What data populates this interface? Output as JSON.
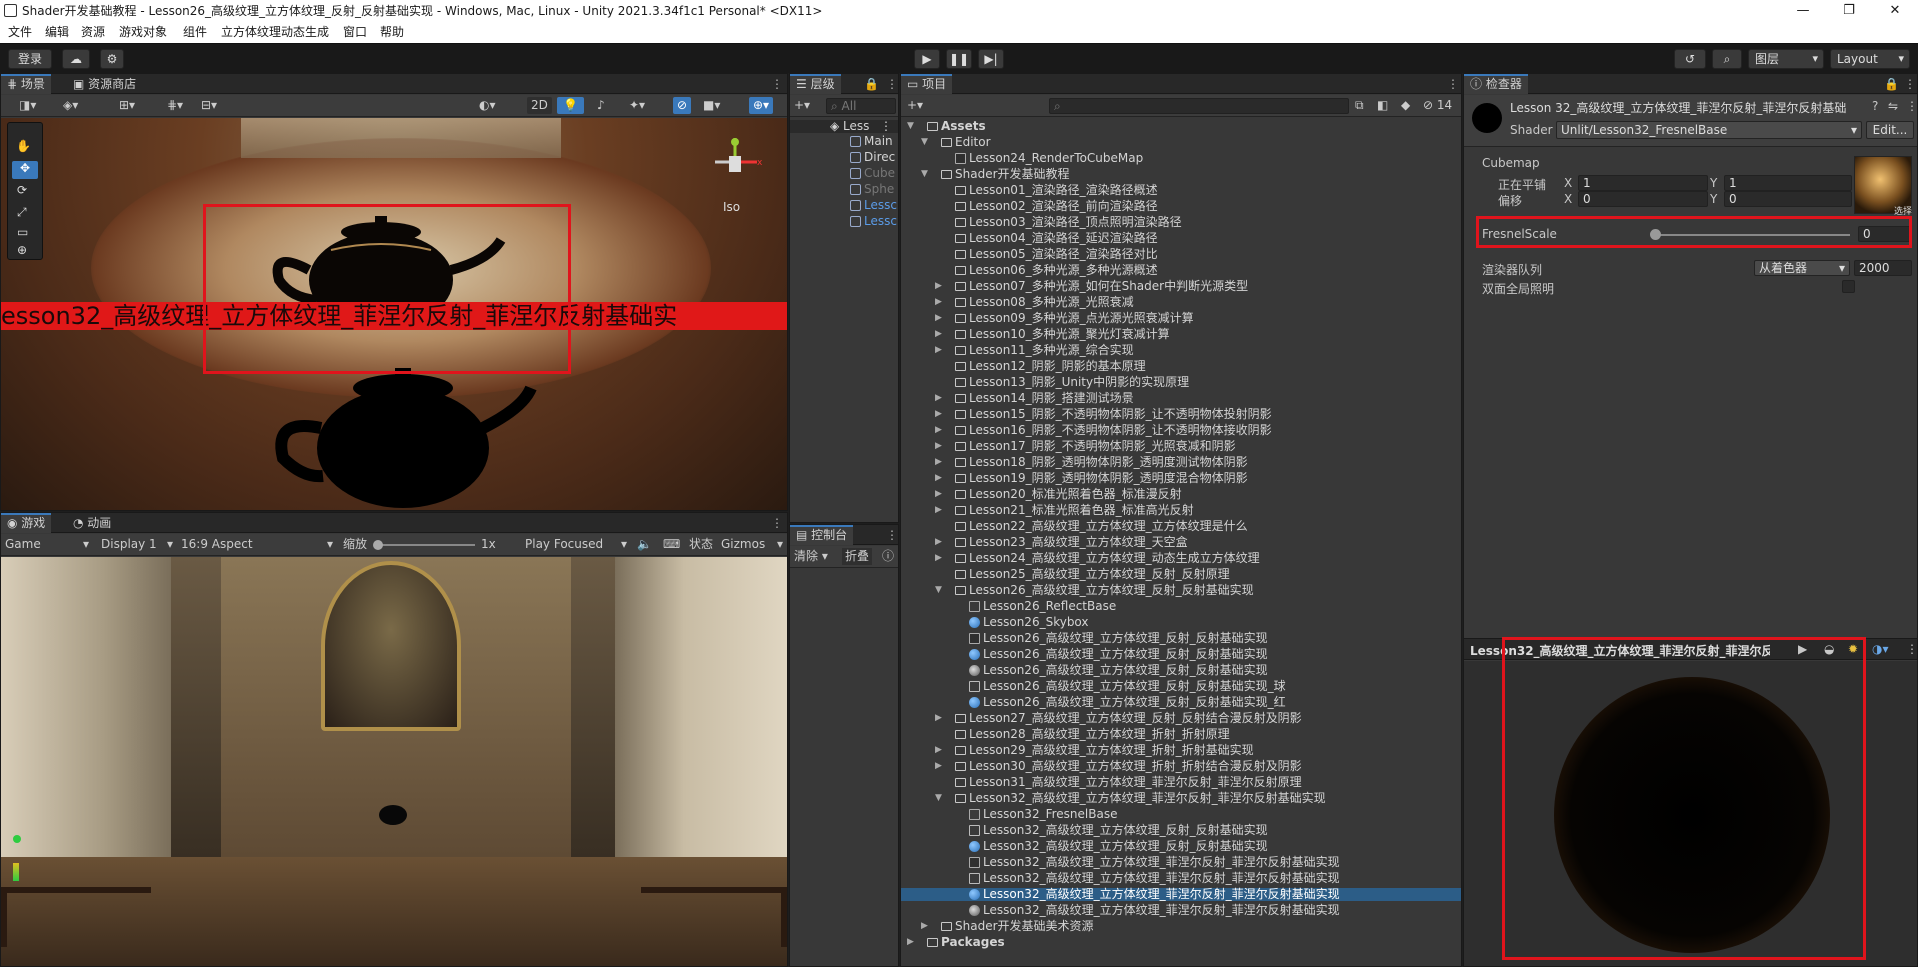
{
  "window": {
    "title": "Shader开发基础教程 - Lesson26_高级纹理_立方体纹理_反射_反射基础实现 - Windows, Mac, Linux - Unity 2021.3.34f1c1 Personal* <DX11>",
    "minimize": "—",
    "maximize": "❐",
    "close": "✕"
  },
  "menu": [
    "文件",
    "编辑",
    "资源",
    "游戏对象",
    "组件",
    "立方体纹理动态生成",
    "窗口",
    "帮助"
  ],
  "toolbar": {
    "login": "登录",
    "layers": "图层",
    "layout": "Layout"
  },
  "scene": {
    "tab_scene": "场景",
    "tab_store": "资源商店",
    "mode_2d": "2D",
    "gizmo_label": "Iso",
    "banner_text": "esson32_高级纹理_立方体纹理_菲涅尔反射_菲涅尔反射基础实"
  },
  "game": {
    "tab_game": "游戏",
    "tab_anim": "动画",
    "display_mode": "Game",
    "display": "Display 1",
    "aspect": "16:9 Aspect",
    "scale_label": "缩放",
    "scale_value": "1x",
    "play_focused": "Play Focused",
    "stats": "状态",
    "gizmos": "Gizmos"
  },
  "hierarchy": {
    "tab": "层级",
    "search_placeholder": "All",
    "items": [
      "Less",
      "Main",
      "Direc",
      "Cube",
      "Sphe",
      "Lessc",
      "Lessc"
    ]
  },
  "console": {
    "tab": "控制台",
    "clear": "清除",
    "collapse": "折叠"
  },
  "project": {
    "tab": "项目",
    "hidden_count": "14",
    "assets_root": "Assets",
    "editor_folder": "Editor",
    "editor_item": "Lesson24_RenderToCubeMap",
    "shader_folder": "Shader开发基础教程",
    "lessons": [
      "Lesson01_渲染路径_渲染路径概述",
      "Lesson02_渲染路径_前向渲染路径",
      "Lesson03_渲染路径_顶点照明渲染路径",
      "Lesson04_渲染路径_延迟渲染路径",
      "Lesson05_渲染路径_渲染路径对比",
      "Lesson06_多种光源_多种光源概述",
      "Lesson07_多种光源_如何在Shader中判断光源类型",
      "Lesson08_多种光源_光照衰减",
      "Lesson09_多种光源_点光源光照衰减计算",
      "Lesson10_多种光源_聚光灯衰减计算",
      "Lesson11_多种光源_综合实现",
      "Lesson12_阴影_阴影的基本原理",
      "Lesson13_阴影_Unity中阴影的实现原理",
      "Lesson14_阴影_搭建测试场景",
      "Lesson15_阴影_不透明物体阴影_让不透明物体投射阴影",
      "Lesson16_阴影_不透明物体阴影_让不透明物体接收阴影",
      "Lesson17_阴影_不透明物体阴影_光照衰减和阴影",
      "Lesson18_阴影_透明物体阴影_透明度测试物体阴影",
      "Lesson19_阴影_透明物体阴影_透明度混合物体阴影",
      "Lesson20_标准光照着色器_标准漫反射",
      "Lesson21_标准光照着色器_标准高光反射",
      "Lesson22_高级纹理_立方体纹理_立方体纹理是什么",
      "Lesson23_高级纹理_立方体纹理_天空盒",
      "Lesson24_高级纹理_立方体纹理_动态生成立方体纹理",
      "Lesson25_高级纹理_立方体纹理_反射_反射原理",
      "Lesson26_高级纹理_立方体纹理_反射_反射基础实现",
      "Lesson26_ReflectBase",
      "Lesson26_Skybox",
      "Lesson26_高级纹理_立方体纹理_反射_反射基础实现",
      "Lesson26_高级纹理_立方体纹理_反射_反射基础实现",
      "Lesson26_高级纹理_立方体纹理_反射_反射基础实现",
      "Lesson26_高级纹理_立方体纹理_反射_反射基础实现_球",
      "Lesson26_高级纹理_立方体纹理_反射_反射基础实现_红",
      "Lesson27_高级纹理_立方体纹理_反射_反射结合漫反射及阴影",
      "Lesson28_高级纹理_立方体纹理_折射_折射原理",
      "Lesson29_高级纹理_立方体纹理_折射_折射基础实现",
      "Lesson30_高级纹理_立方体纹理_折射_折射结合漫反射及阴影",
      "Lesson31_高级纹理_立方体纹理_菲涅尔反射_菲涅尔反射原理",
      "Lesson32_高级纹理_立方体纹理_菲涅尔反射_菲涅尔反射基础实现",
      "Lesson32_FresnelBase",
      "Lesson32_高级纹理_立方体纹理_反射_反射基础实现",
      "Lesson32_高级纹理_立方体纹理_反射_反射基础实现",
      "Lesson32_高级纹理_立方体纹理_菲涅尔反射_菲涅尔反射基础实现",
      "Lesson32_高级纹理_立方体纹理_菲涅尔反射_菲涅尔反射基础实现",
      "Lesson32_高级纹理_立方体纹理_菲涅尔反射_菲涅尔反射基础实现",
      "Lesson32_高级纹理_立方体纹理_菲涅尔反射_菲涅尔反射基础实现"
    ],
    "art_folder": "Shader开发基础美术资源",
    "packages": "Packages"
  },
  "inspector": {
    "tab": "检查器",
    "material_name": "Lesson 32_高级纹理_立方体纹理_菲涅尔反射_菲涅尔反射基础",
    "shader_label": "Shader",
    "shader_value": "Unlit/Lesson32_FresnelBase",
    "edit": "Edit...",
    "cubemap_label": "Cubemap",
    "tiling_label": "正在平铺",
    "offset_label": "偏移",
    "x": "X",
    "y": "Y",
    "tiling_x": "1",
    "tiling_y": "1",
    "offset_x": "0",
    "offset_y": "0",
    "select": "选择",
    "fresnel_label": "FresnelScale",
    "fresnel_value": "0",
    "render_queue_label": "渲染器队列",
    "render_queue_mode": "从着色器",
    "render_queue_value": "2000",
    "double_sided": "双面全局照明",
    "preview_title": "Lesson32_高级纹理_立方体纹理_菲涅尔反射_菲涅尔反"
  },
  "colors": {
    "accent": "#3a79bb",
    "selection": "#2c5d87",
    "annotation": "#e0141c"
  }
}
